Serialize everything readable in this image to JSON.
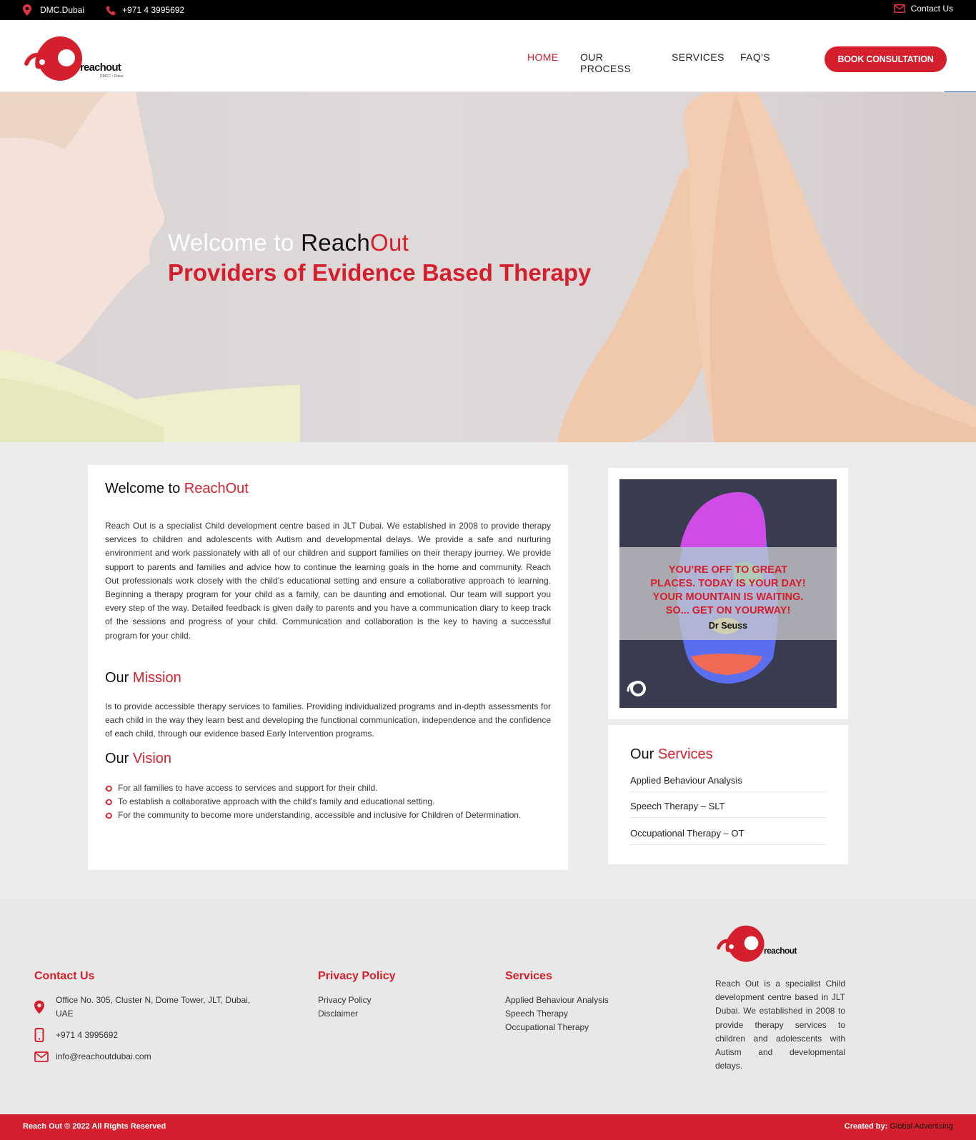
{
  "topbar": {
    "location": "DMC.Dubai",
    "phone": "+971 4 3995692",
    "contact": "Contact Us"
  },
  "brand": {
    "logo_word": "reachout",
    "logo_sub": "DMCC • Dubai",
    "accent": "#d51f2d"
  },
  "nav": {
    "items": [
      "HOME",
      "OUR PROCESS",
      "SERVICES",
      "FAQ'S"
    ],
    "active": "HOME",
    "cta": "BOOK CONSULTATION"
  },
  "social": {
    "facebook": "f",
    "linkedin": "in",
    "instagram": "instagram-icon"
  },
  "hero": {
    "welcome": "Welcome to ",
    "reach": "Reach",
    "out": "Out",
    "tagline": "Providers of Evidence Based Therapy"
  },
  "main": {
    "welcome_prefix": "Welcome to ",
    "welcome_brand": "ReachOut",
    "intro": "Reach Out is a specialist Child development centre based in JLT Dubai. We established in 2008 to provide therapy services to children and adolescents with Autism and developmental delays. We provide a safe and nurturing environment and work passionately with all of our children and support families on their therapy journey. We provide support to parents and families and advice how to continue the learning goals in the home and community.  Reach Out professionals work closely with the child’s educational setting and ensure a collaborative approach to learning. Beginning a therapy program for your child as a family, can be daunting and emotional. Our team will support you every step of the way. Detailed feedback is given daily to parents and you have a communication diary to keep track of the sessions and progress of your child. Communication and collaboration is the key to having a successful program for your child.",
    "mission_prefix": "Our ",
    "mission_word": "Mission",
    "mission_text": "Is to provide accessible therapy services to families. Providing individualized programs and in-depth assessments for each child in the way they learn best and developing the functional communication, independence and the confidence of each child, through our evidence based Early Intervention programs.",
    "vision_prefix": "Our ",
    "vision_word": "Vision",
    "vision_items": [
      "For all families to have access to services and support for their child.",
      "To establish a collaborative approach with the child’s family and educational setting.",
      "For the community to become more understanding, accessible and inclusive for Children of Determination."
    ]
  },
  "quote": {
    "line1": "YOU’RE OFF TO GREAT",
    "line2": "PLACES. TODAY IS YOUR DAY!",
    "line3": "YOUR MOUNTAIN IS WAITING.",
    "line4": "SO... GET ON YOURWAY!",
    "author": "Dr Seuss"
  },
  "services_widget": {
    "prefix": "Our ",
    "word": "Services",
    "items": [
      "Applied Behaviour Analysis",
      "Speech Therapy – SLT",
      "Occupational Therapy – OT"
    ]
  },
  "footer": {
    "contact_title": "Contact Us",
    "address_line1": "Office No. 305, Cluster N, Dome Tower, JLT, Dubai,",
    "address_line2": "UAE",
    "phone": "+971 4 3995692",
    "email": "info@reachoutdubai.com",
    "privacy_title": "Privacy Policy",
    "privacy_links": [
      "Privacy Policy",
      "Disclaimer"
    ],
    "services_title": "Services",
    "services_links": [
      "Applied Behaviour Analysis",
      "Speech Therapy",
      "Occupational Therapy"
    ],
    "about": "Reach Out is a specialist Child development centre based in JLT Dubai. We established in 2008 to provide therapy services to children and adolescents with Autism and developmental delays."
  },
  "bottombar": {
    "copyright": "Reach Out © 2022  All Rights Reserved",
    "created_label": "Created by:",
    "created_by": " Global Advertising"
  }
}
